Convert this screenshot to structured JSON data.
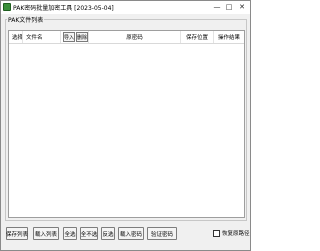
{
  "window": {
    "title": "PAK密码批量加密工具 [2023-05-04]"
  },
  "titlebar_buttons": {
    "minimize": "—",
    "maximize": "□",
    "close": "✕"
  },
  "group": {
    "label": "PAK文件列表"
  },
  "table": {
    "columns": [
      "选择",
      "文件名",
      "导入",
      "删除",
      "原密码",
      "保存位置",
      "操作结果"
    ],
    "rows": []
  },
  "buttons": {
    "save_list": "保存列表",
    "load_list": "载入列表",
    "select_all": "全选",
    "select_none": "全不选",
    "invert": "反选",
    "import_password": "载入密码",
    "verify_password": "验证密码"
  },
  "checkbox": {
    "label": "恢复原路径",
    "checked": false
  },
  "icons": {
    "app": "app-icon"
  }
}
